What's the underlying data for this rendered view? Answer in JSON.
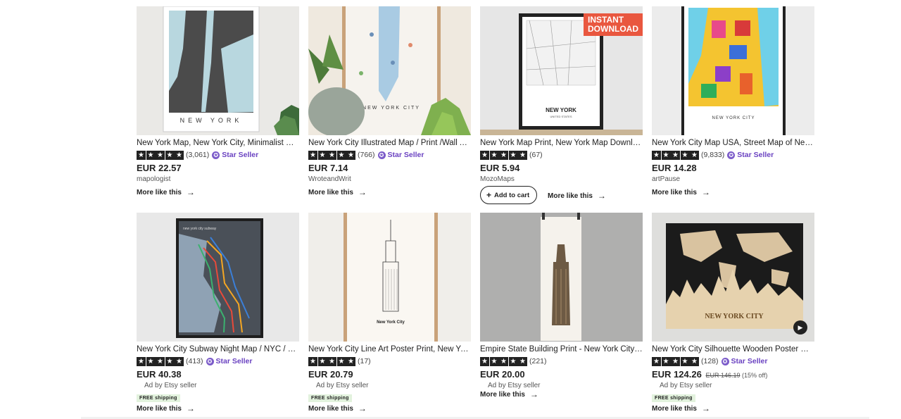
{
  "listings": [
    {
      "title": "New York Map, New York City, Minimalist Map, New York Poster, Map Print",
      "rating_count": "(3,061)",
      "star_seller": "Star Seller",
      "price": "EUR 22.57",
      "shop": "mapologist",
      "more": "More like this",
      "thumb_caption": "NEW YORK"
    },
    {
      "title": "New York City Illustrated Map / Print /Wall Art / Poster",
      "rating_count": "(766)",
      "star_seller": "Star Seller",
      "price": "EUR 7.14",
      "shop": "WroteandWrit",
      "more": "More like this",
      "thumb_caption": "NEW YORK CITY"
    },
    {
      "title": "New York Map Print, New York Map Download, New York City Map",
      "rating_count": "(67)",
      "price": "EUR 5.94",
      "shop": "MozoMaps",
      "add_to_cart": "Add to cart",
      "more": "More like this",
      "badge_line1": "INSTANT",
      "badge_line2": "DOWNLOAD",
      "thumb_caption": "NEW YORK",
      "thumb_sub": "UNITED STATES"
    },
    {
      "title": "New York City Map USA, Street Map of New York City Poster",
      "rating_count": "(9,833)",
      "star_seller": "Star Seller",
      "price": "EUR 14.28",
      "shop": "artPause",
      "more": "More like this",
      "thumb_caption": "NEW YORK CITY"
    },
    {
      "title": "New York City Subway Night Map / NYC / Minimalist Poster",
      "rating_count": "(413)",
      "star_seller": "Star Seller",
      "price": "EUR 40.38",
      "shop": "Ad by Etsy seller",
      "free_shipping": "FREE shipping",
      "more": "More like this",
      "thumb_caption": "new york city subway"
    },
    {
      "title": "New York City Line Art Poster Print, New York City Skyline",
      "rating_count": "(17)",
      "price": "EUR 20.79",
      "shop": "Ad by Etsy seller",
      "free_shipping": "FREE shipping",
      "more": "More like this",
      "thumb_caption": "New York City"
    },
    {
      "title": "Empire State Building Print - New York City Art Print",
      "rating_count": "(221)",
      "price": "EUR 20.00",
      "shop": "Ad by Etsy seller",
      "more": "More like this"
    },
    {
      "title": "New York City Silhouette Wooden Poster City detailed map",
      "rating_count": "(128)",
      "star_seller": "Star Seller",
      "price": "EUR 124.26",
      "original_price": "EUR 146.19",
      "discount": "(15% off)",
      "shop": "Ad by Etsy seller",
      "free_shipping": "FREE shipping",
      "more": "More like this",
      "thumb_caption": "NEW YORK CITY"
    }
  ],
  "colors": {
    "star_seller": "#6a42c1",
    "instant_badge": "#e9573f",
    "free_shipping_bg": "#e2f2dd"
  }
}
